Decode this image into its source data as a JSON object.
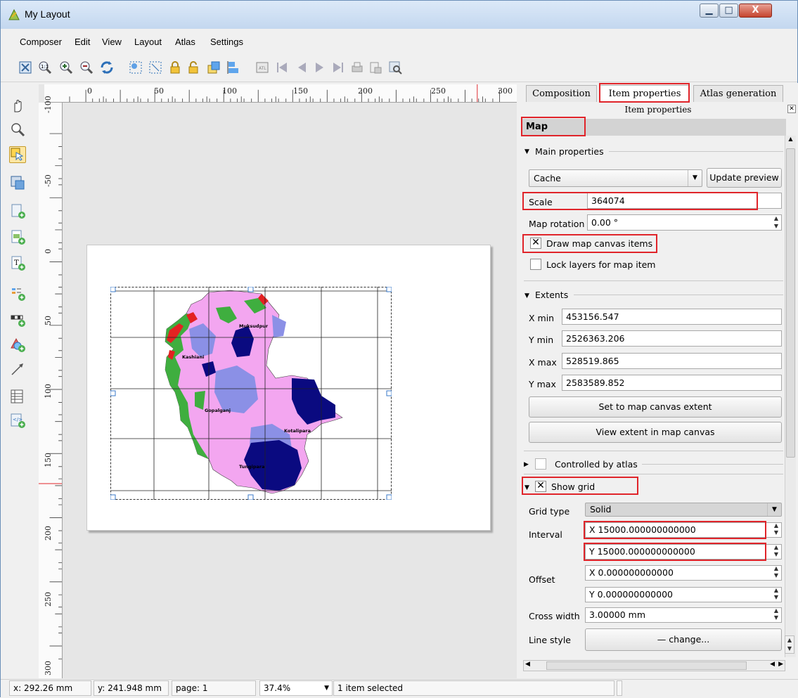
{
  "window": {
    "title": "My Layout"
  },
  "menu": [
    "Composer",
    "Edit",
    "View",
    "Layout",
    "Atlas",
    "Settings"
  ],
  "rulers": {
    "horizontal": [
      "0",
      "50",
      "100",
      "150",
      "200",
      "250",
      "300"
    ],
    "vertical": [
      "-100",
      "-50",
      "0",
      "50",
      "100",
      "150",
      "200",
      "250",
      "300"
    ]
  },
  "map": {
    "labels": [
      "Muksudpur",
      "Kashiani",
      "Gopalganj",
      "Kotalipara",
      "Tungipara"
    ]
  },
  "tabs": [
    "Composition",
    "Item properties",
    "Atlas generation"
  ],
  "panel": {
    "title": "Item properties",
    "section": "Map",
    "main_properties": "Main properties",
    "cache_value": "Cache",
    "update_preview": "Update preview",
    "scale_label": "Scale",
    "scale_value": "364074",
    "rotation_label": "Map rotation",
    "rotation_value": "0.00 °",
    "draw_canvas_items": "Draw map canvas items",
    "lock_layers": "Lock layers for map item",
    "extents": "Extents",
    "xmin_label": "X min",
    "xmin_value": "453156.547",
    "ymin_label": "Y min",
    "ymin_value": "2526363.206",
    "xmax_label": "X max",
    "xmax_value": "528519.865",
    "ymax_label": "Y max",
    "ymax_value": "2583589.852",
    "set_extent": "Set to map canvas extent",
    "view_extent": "View extent in map canvas",
    "controlled_by_atlas": "Controlled by atlas",
    "show_grid": "Show grid",
    "grid_type_label": "Grid type",
    "grid_type_value": "Solid",
    "interval_label": "Interval",
    "interval_x": "X 15000.000000000000",
    "interval_y": "Y 15000.000000000000",
    "offset_label": "Offset",
    "offset_x": "X 0.000000000000",
    "offset_y": "Y 0.000000000000",
    "cross_width_label": "Cross width",
    "cross_width_value": "3.00000 mm",
    "line_style_label": "Line style",
    "line_style_button": "— change..."
  },
  "status": {
    "x": "x: 292.26 mm",
    "y": "y: 241.948 mm",
    "page": "page: 1",
    "zoom": "37.4%",
    "selection": "1 item selected"
  },
  "colors": {
    "highlight": "#e0242a",
    "map_pink": "#f3a6f0",
    "map_blue": "#8b90e6",
    "map_navy": "#0a0a80",
    "map_green": "#3fae3f",
    "map_red": "#e32222"
  }
}
